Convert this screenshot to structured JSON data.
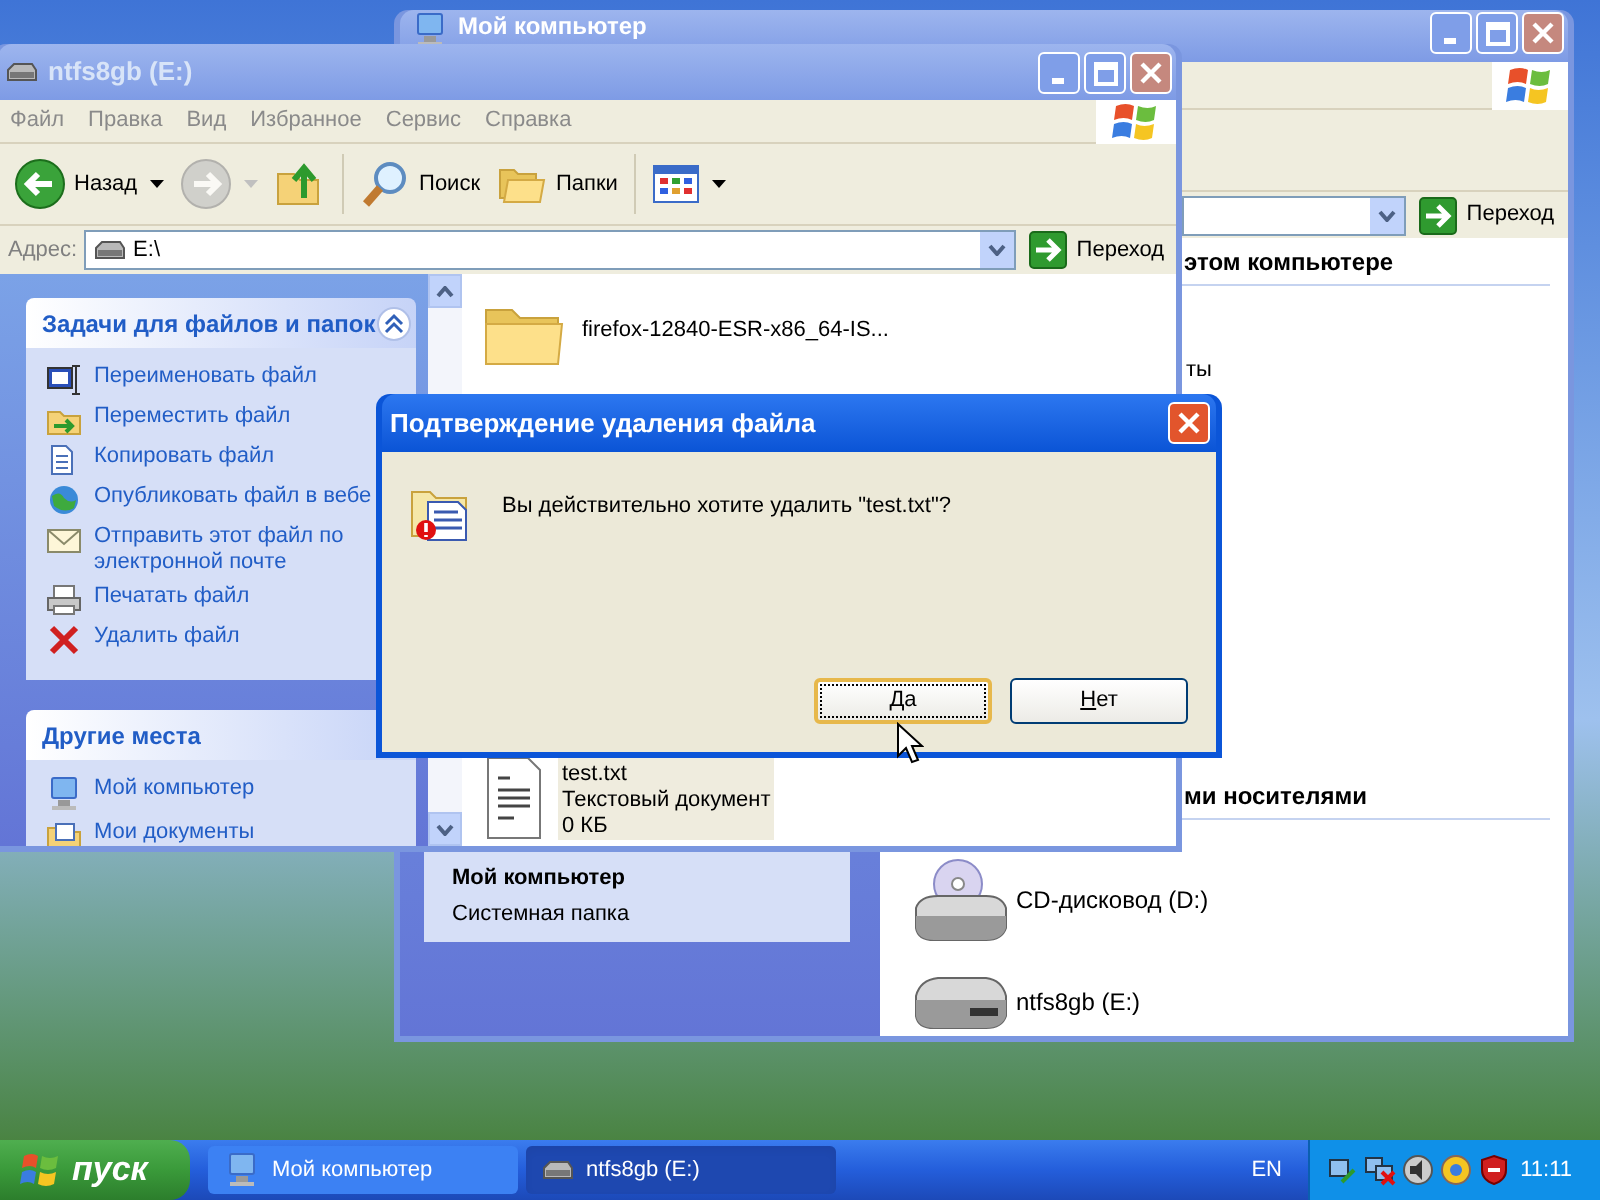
{
  "my_computer_window": {
    "title": "Мой компьютер",
    "go_button": "Переход",
    "headings": [
      "этом компьютере",
      "ми носителями"
    ],
    "fragment": "ты",
    "details": {
      "title": "Мой компьютер",
      "subtitle": "Системная папка"
    },
    "drives": [
      {
        "kind": "cd",
        "label": "CD-дисковод (D:)"
      },
      {
        "kind": "hdd",
        "label": "ntfs8gb (E:)"
      }
    ]
  },
  "drive_window": {
    "title": "ntfs8gb (E:)",
    "menu": [
      "Файл",
      "Правка",
      "Вид",
      "Избранное",
      "Сервис",
      "Справка"
    ],
    "toolbar": [
      {
        "kind": "back",
        "label": "Назад",
        "disabled": false
      },
      {
        "kind": "forward",
        "disabled": true
      },
      {
        "kind": "up",
        "disabled": false
      },
      {
        "kind": "search",
        "label": "Поиск",
        "disabled": false
      },
      {
        "kind": "folders",
        "label": "Папки",
        "disabled": false
      },
      {
        "kind": "views",
        "disabled": false
      }
    ],
    "address_label": "Адрес:",
    "address": "E:\\",
    "go_button": "Переход",
    "panels": [
      {
        "title": "Задачи для файлов и папок",
        "collapse_button": true,
        "items": [
          {
            "kind": "rename",
            "label": "Переименовать файл"
          },
          {
            "kind": "move",
            "label": "Переместить файл"
          },
          {
            "kind": "copy",
            "label": "Копировать файл"
          },
          {
            "kind": "publish",
            "label": "Опубликовать файл в вебе"
          },
          {
            "kind": "email",
            "label": "Отправить этот файл по электронной почте"
          },
          {
            "kind": "print",
            "label": "Печатать файл"
          },
          {
            "kind": "delete",
            "label": "Удалить файл"
          }
        ]
      },
      {
        "title": "Другие места",
        "collapse_button": false,
        "items": [
          {
            "kind": "computer",
            "label": "Мой компьютер"
          },
          {
            "kind": "documents",
            "label": "Мои документы"
          }
        ]
      }
    ],
    "files": [
      {
        "kind": "folder",
        "name": "firefox-12840-ESR-x86_64-IS...",
        "selected": false
      },
      {
        "kind": "text",
        "name": "test.txt",
        "type": "Текстовый документ",
        "size": "0 КБ",
        "selected": true
      }
    ]
  },
  "dialog": {
    "title": "Подтверждение удаления файла",
    "message": "Вы действительно хотите удалить \"test.txt\"?",
    "buttons": [
      {
        "label": "Да",
        "focused": true
      },
      {
        "label": "Нет",
        "focused": false
      }
    ]
  },
  "taskbar": {
    "start": "пуск",
    "tasks": [
      {
        "kind": "computer",
        "label": "Мой компьютер",
        "active": false
      },
      {
        "kind": "drive",
        "label": "ntfs8gb (E:)",
        "active": true
      }
    ],
    "language": "EN",
    "clock": "11:11"
  }
}
